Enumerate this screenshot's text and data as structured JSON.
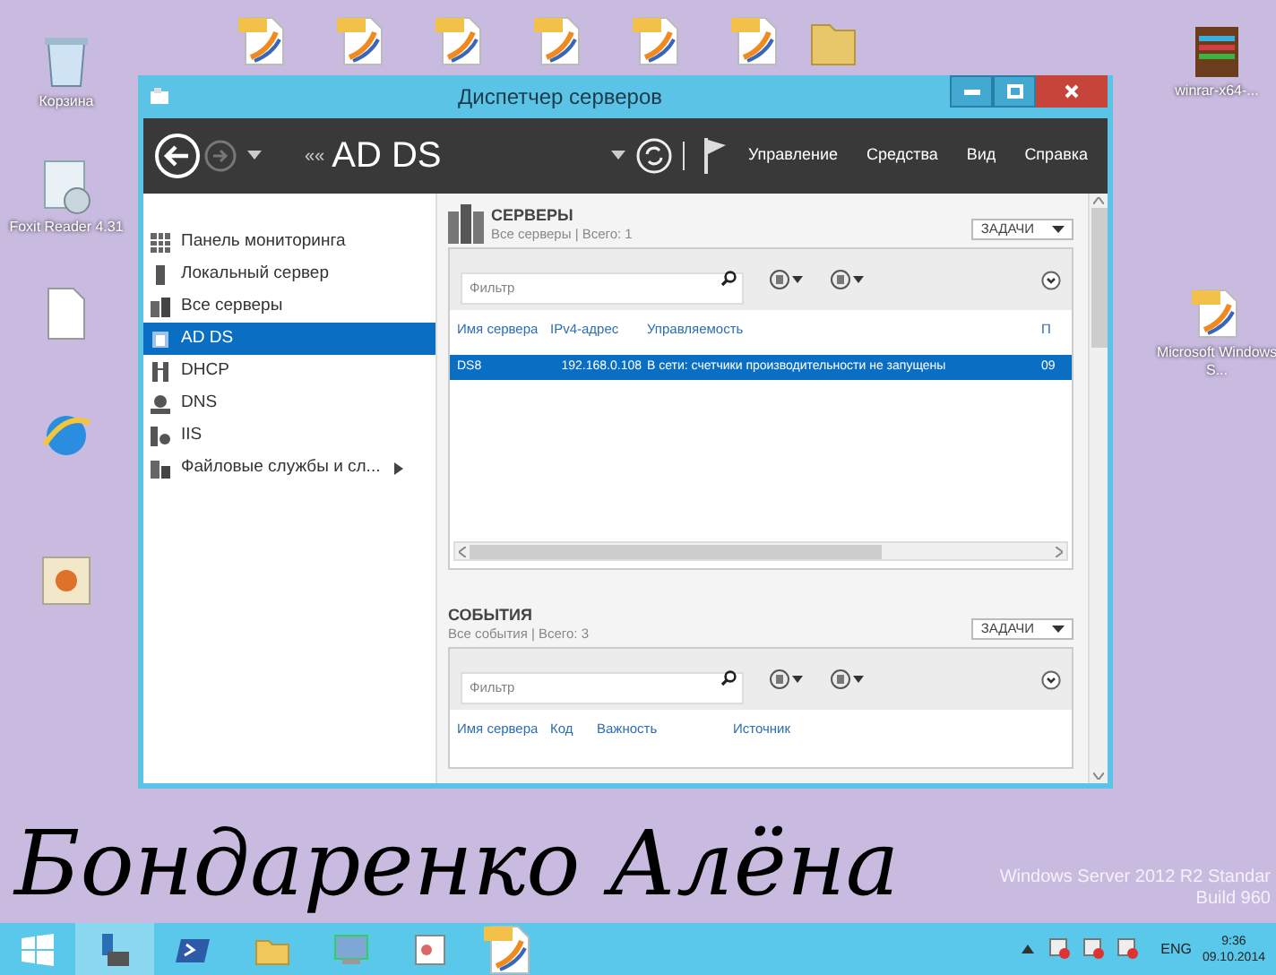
{
  "desktop": {
    "icons_left": [
      {
        "kind": "bin",
        "label": "Корзина"
      },
      {
        "kind": "reader",
        "label": "Foxit Reader 4.31"
      },
      {
        "kind": "doc"
      },
      {
        "kind": "browser"
      },
      {
        "kind": "flower"
      }
    ],
    "icons_top": [
      {
        "kind": "pdf"
      },
      {
        "kind": "pdf"
      },
      {
        "kind": "pdf"
      },
      {
        "kind": "pdf"
      },
      {
        "kind": "pdf"
      },
      {
        "kind": "pdf"
      },
      {
        "kind": "folder"
      }
    ],
    "icons_right": [
      {
        "kind": "archive",
        "label": "winrar-x64-..."
      },
      {
        "kind": "pdf",
        "label": "Microsoft Windows S..."
      }
    ],
    "handwriting": "Бондаренко Алёна",
    "watermark": [
      "Windows Server 2012 R2 Standar",
      "Build 960"
    ]
  },
  "window": {
    "title": "Диспетчер серверов",
    "toolbar": {
      "breadcrumb_arrows": "««",
      "breadcrumb": "AD DS",
      "menu": [
        "Управление",
        "Средства",
        "Вид",
        "Справка"
      ]
    },
    "sidebar": {
      "items": [
        {
          "label": "Панель мониторинга",
          "selected": false
        },
        {
          "label": "Локальный сервер",
          "selected": false
        },
        {
          "label": "Все серверы",
          "selected": false
        },
        {
          "label": "AD DS",
          "selected": true
        },
        {
          "label": "DHCP",
          "selected": false
        },
        {
          "label": "DNS",
          "selected": false
        },
        {
          "label": "IIS",
          "selected": false
        },
        {
          "label": "Файловые службы и сл...",
          "selected": false,
          "expandable": true
        }
      ]
    },
    "sections": [
      {
        "title": "СЕРВЕРЫ",
        "subtitle": "Все серверы | Всего: 1",
        "tasks": "ЗАДАЧИ",
        "filter_placeholder": "Фильтр",
        "columns": [
          "Имя сервера",
          "IPv4-адрес",
          "Управляемость",
          "П"
        ],
        "rows": [
          {
            "cells": [
              "DS8",
              "192.168.0.108",
              "В сети: счетчики производительности не запущены",
              "09"
            ],
            "selected": true
          }
        ]
      },
      {
        "title": "СОБЫТИЯ",
        "subtitle": "Все события | Всего: 3",
        "tasks": "ЗАДАЧИ",
        "filter_placeholder": "Фильтр",
        "columns": [
          "Имя сервера",
          "Код",
          "Важность",
          "Источник"
        ]
      }
    ]
  },
  "taskbar": {
    "language": "ENG",
    "time": "9:36",
    "date": "09.10.2014"
  }
}
